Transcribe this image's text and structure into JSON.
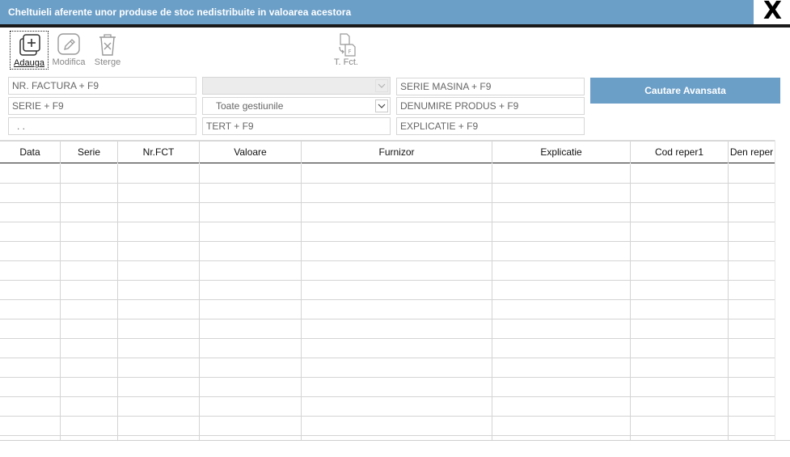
{
  "window": {
    "title": "Cheltuieli aferente unor produse de stoc nedistribuite in valoarea acestora",
    "close_label": "X"
  },
  "toolbar": {
    "add_label": "Adauga",
    "edit_label": "Modifica",
    "delete_label": "Sterge",
    "tfct_label": "T. Fct."
  },
  "filters": {
    "nr_factura": "NR. FACTURA + F9",
    "serie": "SERIE + F9",
    "date_range": ". .",
    "dropdown_top_value": "",
    "gestiune": "Toate gestiunile",
    "tert": "TERT + F9",
    "serie_masina": "SERIE MASINA + F9",
    "denumire_produs": "DENUMIRE PRODUS + F9",
    "explicatie": "EXPLICATIE + F9",
    "advanced_search_label": "Cautare Avansata"
  },
  "table": {
    "columns": [
      "Data",
      "Serie",
      "Nr.FCT",
      "Valoare",
      "Furnizor",
      "Explicatie",
      "Cod reper1",
      "Den reper"
    ],
    "rows": []
  }
}
